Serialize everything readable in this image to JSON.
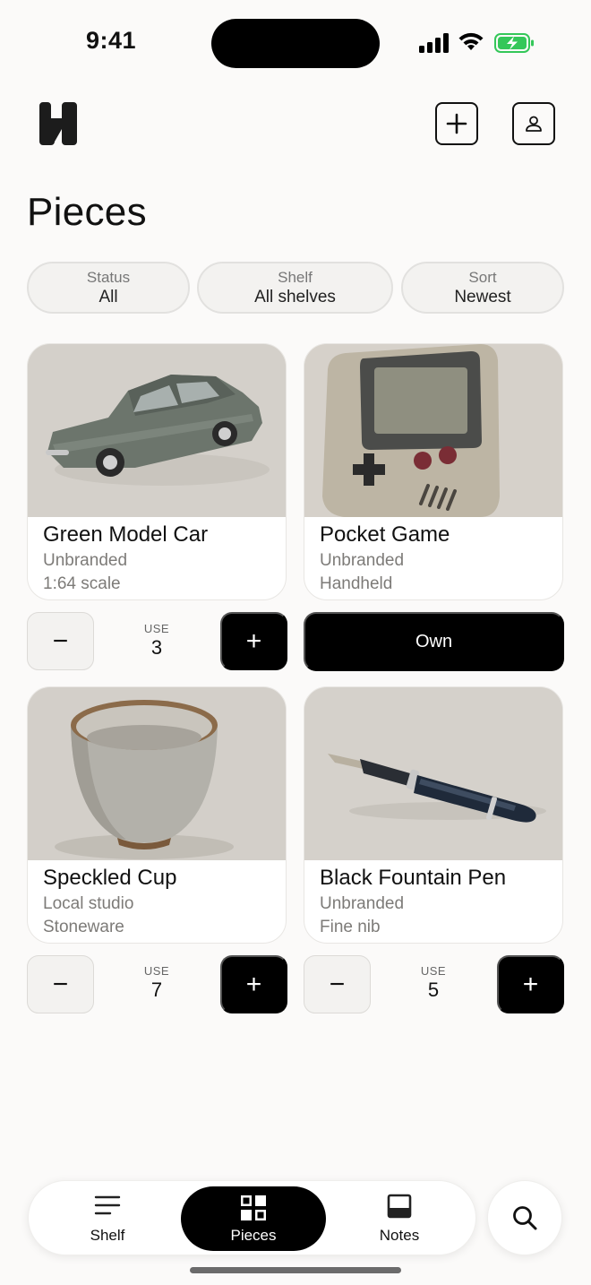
{
  "status_bar": {
    "time": "9:41"
  },
  "header": {
    "title": "Pieces",
    "add_icon": "plus-square-icon",
    "profile_icon": "user-icon"
  },
  "filters": [
    {
      "label": "Status",
      "value": "All"
    },
    {
      "label": "Shelf",
      "value": "All shelves"
    },
    {
      "label": "Sort",
      "value": "Newest"
    }
  ],
  "pieces": [
    {
      "name": "Green Model Car",
      "brand": "Unbranded",
      "detail": "1:64 scale",
      "use_label": "USE",
      "use": "3"
    },
    {
      "name": "Pocket Game",
      "brand": "Unbranded",
      "detail": "Handheld",
      "action": "Own"
    },
    {
      "name": "Speckled Cup",
      "brand": "Local studio",
      "detail": "Stoneware",
      "use_label": "USE",
      "use": "7"
    },
    {
      "name": "Black Fountain Pen",
      "brand": "Unbranded",
      "detail": "Fine nib",
      "use_label": "USE",
      "use": "5"
    }
  ],
  "counter": {
    "minus": "−",
    "plus": "+"
  },
  "nav": {
    "tabs": [
      {
        "label": "Shelf",
        "icon": "menu-lines-icon"
      },
      {
        "label": "Pieces",
        "icon": "grid-icon",
        "active": true
      },
      {
        "label": "Notes",
        "icon": "note-icon"
      }
    ],
    "search_icon": "search-icon"
  },
  "colors": {
    "background": "#fbfaf9",
    "accent": "#000000",
    "battery": "#34c759"
  }
}
